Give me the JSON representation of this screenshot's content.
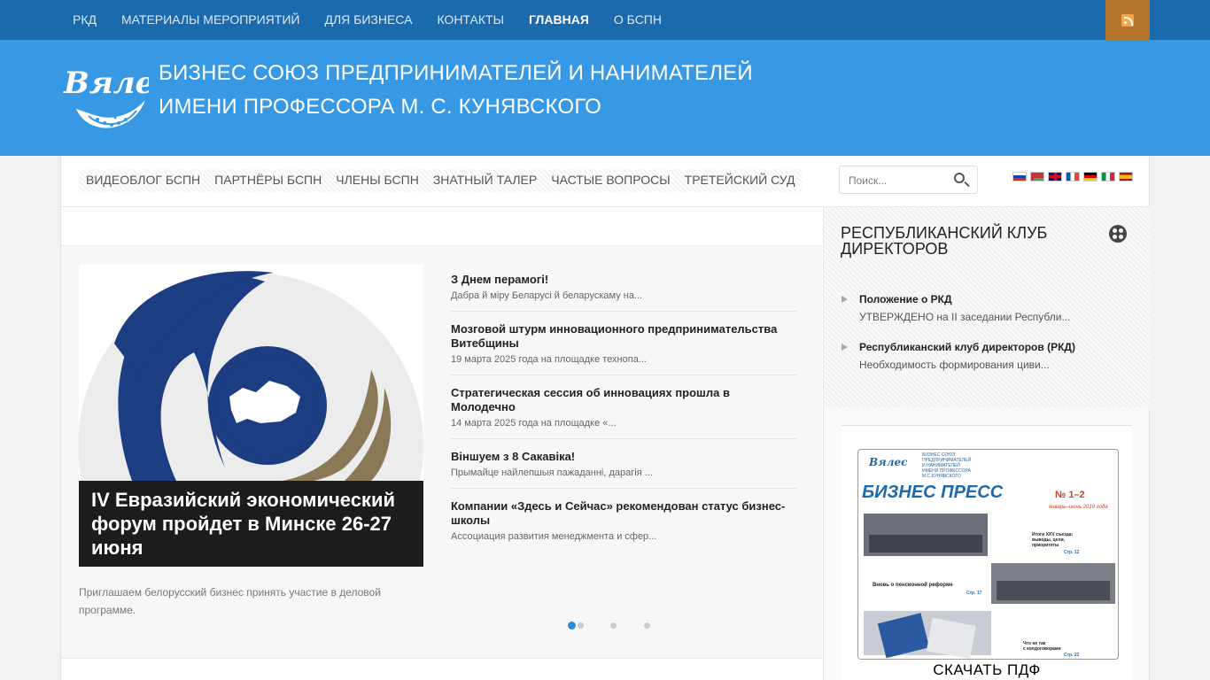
{
  "topnav": {
    "items": [
      "РКД",
      "МАТЕРИАЛЫ МЕРОПРИЯТИЙ",
      "ДЛЯ БИЗНЕСА",
      "КОНТАКТЫ",
      "ГЛАВНАЯ",
      "О БСПН"
    ],
    "active": "ГЛАВНАЯ",
    "rss_icon": "rss-icon"
  },
  "header": {
    "logo_text": "Вялес",
    "title_line1": "БИЗНЕС СОЮЗ ПРЕДПРИНИМАТЕЛЕЙ И НАНИМАТЕЛЕЙ",
    "title_line2": "ИМЕНИ ПРОФЕССОРА М. С. КУНЯВСКОГО"
  },
  "subnav": {
    "items": [
      "ВИДЕОБЛОГ БСПН",
      "ПАРТНЁРЫ БСПН",
      "ЧЛЕНЫ БСПН",
      "ЗНАТНЫЙ ТАЛЕР",
      "ЧАСТЫЕ ВОПРОСЫ",
      "ТРЕТЕЙСКИЙ СУД"
    ]
  },
  "search": {
    "placeholder": "Поиск..."
  },
  "languages": [
    "ru",
    "be",
    "en",
    "fr",
    "de",
    "it",
    "es"
  ],
  "featured": {
    "title": "IV Евразийский экономический форум пройдет в Минске 26-27 июня",
    "excerpt": "Приглашаем белорусский бизнес принять участие в деловой программе.",
    "news": [
      {
        "title": "З Днем перамогі!",
        "excerpt": "Дабра й міру Беларусі й беларускаму на..."
      },
      {
        "title": "Мозговой штурм инновационного предпринимательства Витебщины",
        "excerpt": "19 марта 2025 года на площадке технопа..."
      },
      {
        "title": "Стратегическая сессия об инновациях прошла в Молодечно",
        "excerpt": "14 марта 2025 года на площадке «..."
      },
      {
        "title": "Віншуем з 8 Сакавіка!",
        "excerpt": "Прымайце найлепшыя пажаданні, дарагія ..."
      },
      {
        "title": "Компании «Здесь и Сейчас» рекомендован статус бизнес-школы",
        "excerpt": "Ассоциация развития менеджмента и сфер..."
      }
    ],
    "slider_pages": 4,
    "slider_active": 1
  },
  "sidebar": {
    "widget_title": "РЕСПУБЛИКАНСКИЙ КЛУБ ДИРЕКТОРОВ",
    "items": [
      {
        "title": "Положение о РКД",
        "excerpt": "УТВЕРЖДЕНО на II заседании Республи..."
      },
      {
        "title": "Республиканский клуб директоров (РКД)",
        "excerpt": "Необходимость формирования циви..."
      }
    ],
    "cover": {
      "org": "БИЗНЕС СОЮЗ ПРЕДПРИНИМАТЕЛЕЙ И НАНИМАТЕЛЕЙ ИМЕНИ ПРОФЕССОРА М.С.КУНЯВСКОГО",
      "name": "БИЗНЕС ПРЕСС",
      "issue": "№ 1–2",
      "period": "январь–июнь 2019 года",
      "story1": "Итоги XXV съезда: выводы, цели, приоритеты",
      "page1": "Стр. 12",
      "story2": "Вновь о пенсионной реформе",
      "page2": "Стр. 17",
      "story3": "Что не так с колдоговорами",
      "page3": "Стр. 22"
    },
    "download": "СКАЧАТЬ ПДФ"
  },
  "colors": {
    "topbar": "#1b6aae",
    "header": "#3799e4",
    "rss": "#b5742a",
    "accent": "#2b8ad6"
  }
}
